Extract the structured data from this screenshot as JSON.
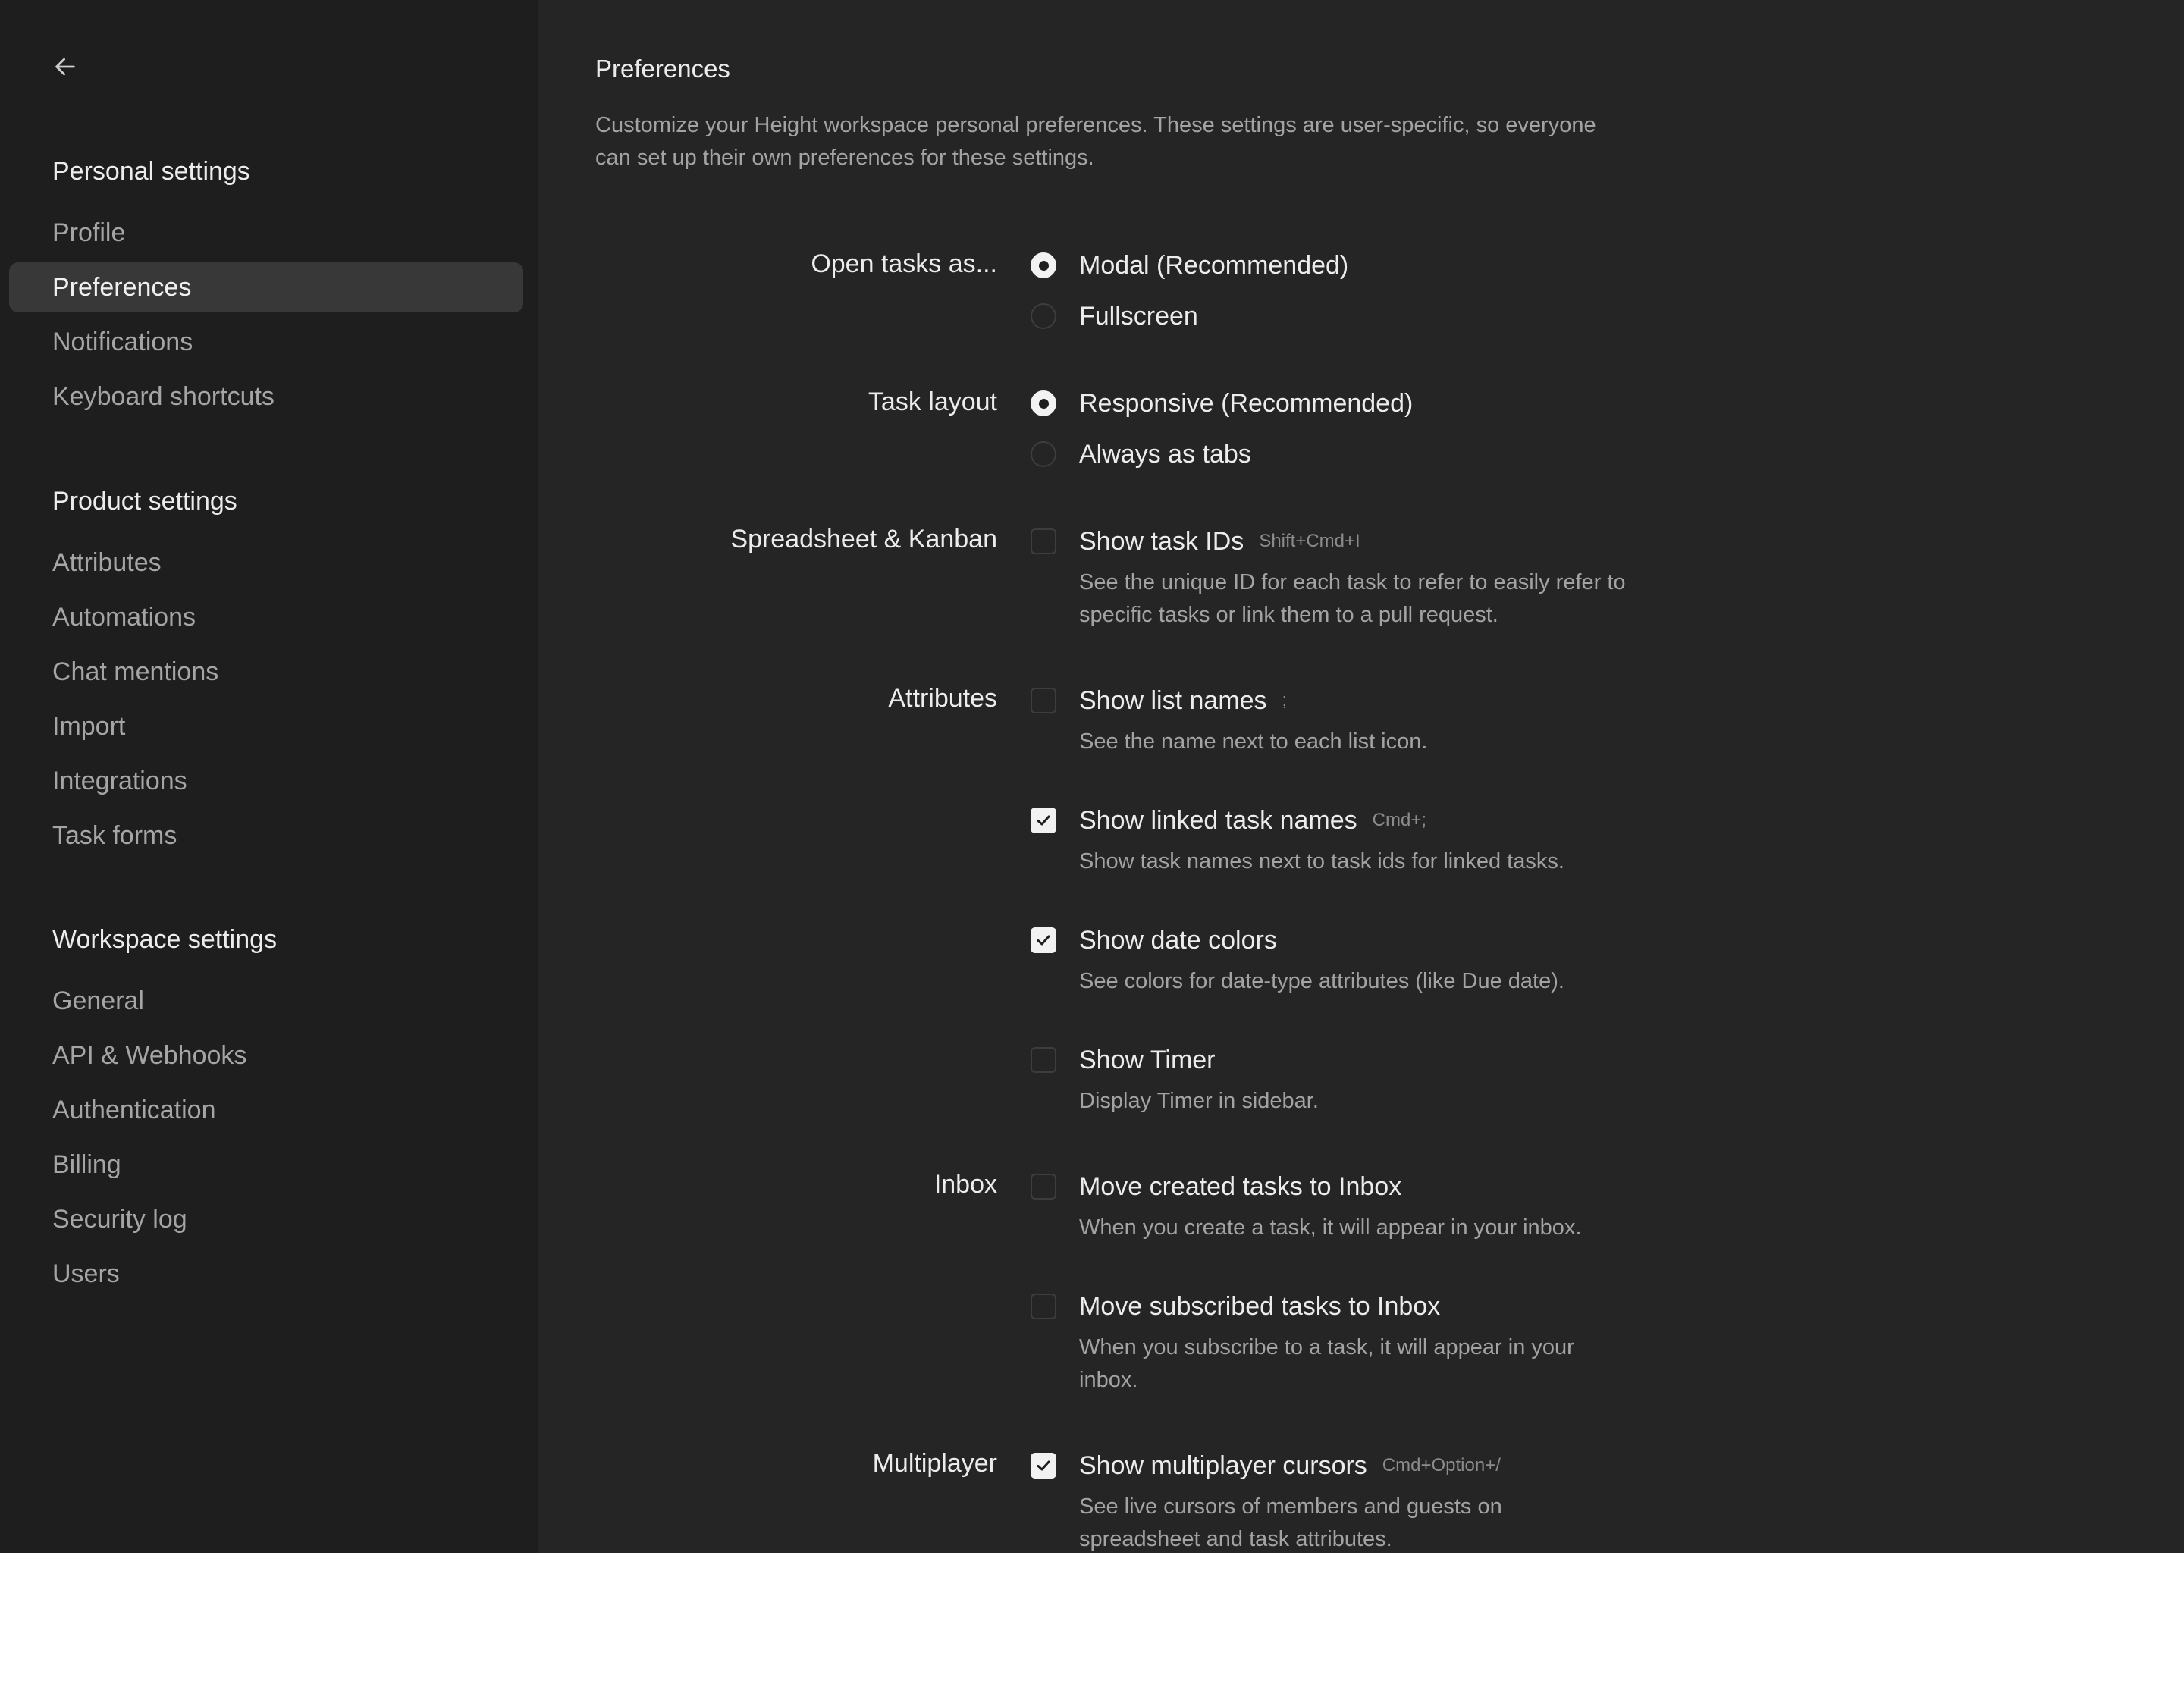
{
  "sidebar": {
    "back_icon": "arrow-left-icon",
    "sections": [
      {
        "heading": "Personal settings",
        "items": [
          {
            "label": "Profile",
            "active": false
          },
          {
            "label": "Preferences",
            "active": true
          },
          {
            "label": "Notifications",
            "active": false
          },
          {
            "label": "Keyboard shortcuts",
            "active": false
          }
        ]
      },
      {
        "heading": "Product settings",
        "items": [
          {
            "label": "Attributes",
            "active": false
          },
          {
            "label": "Automations",
            "active": false
          },
          {
            "label": "Chat mentions",
            "active": false
          },
          {
            "label": "Import",
            "active": false
          },
          {
            "label": "Integrations",
            "active": false
          },
          {
            "label": "Task forms",
            "active": false
          }
        ]
      },
      {
        "heading": "Workspace settings",
        "items": [
          {
            "label": "General",
            "active": false
          },
          {
            "label": "API & Webhooks",
            "active": false
          },
          {
            "label": "Authentication",
            "active": false
          },
          {
            "label": "Billing",
            "active": false
          },
          {
            "label": "Security log",
            "active": false
          },
          {
            "label": "Users",
            "active": false
          }
        ]
      }
    ]
  },
  "main": {
    "title": "Preferences",
    "description": "Customize your Height workspace personal preferences. These settings are user-specific, so everyone can set up their own preferences for these settings.",
    "groups": {
      "open_tasks": {
        "label": "Open tasks as...",
        "options": [
          {
            "label": "Modal (Recommended)",
            "selected": true
          },
          {
            "label": "Fullscreen",
            "selected": false
          }
        ]
      },
      "task_layout": {
        "label": "Task layout",
        "options": [
          {
            "label": "Responsive (Recommended)",
            "selected": true
          },
          {
            "label": "Always as tabs",
            "selected": false
          }
        ]
      },
      "spreadsheet": {
        "label": "Spreadsheet & Kanban",
        "options": [
          {
            "label": "Show task IDs",
            "shortcut": "Shift+Cmd+I",
            "checked": false,
            "description": "See the unique ID for each task to refer to easily refer to specific tasks or link them to a pull request."
          }
        ]
      },
      "attributes": {
        "label": "Attributes",
        "options": [
          {
            "label": "Show list names",
            "shortcut": ";",
            "checked": false,
            "description": "See the name next to each list icon."
          },
          {
            "label": "Show linked task names",
            "shortcut": "Cmd+;",
            "checked": true,
            "description": "Show task names next to task ids for linked tasks."
          },
          {
            "label": "Show date colors",
            "shortcut": "",
            "checked": true,
            "description": "See colors for date-type attributes (like Due date)."
          },
          {
            "label": "Show Timer",
            "shortcut": "",
            "checked": false,
            "description": "Display Timer in sidebar."
          }
        ]
      },
      "inbox": {
        "label": "Inbox",
        "options": [
          {
            "label": "Move created tasks to Inbox",
            "shortcut": "",
            "checked": false,
            "description": "When you create a task, it will appear in your inbox."
          },
          {
            "label": "Move subscribed tasks to Inbox",
            "shortcut": "",
            "checked": false,
            "description": "When you subscribe to a task, it will appear in your inbox."
          }
        ]
      },
      "multiplayer": {
        "label": "Multiplayer",
        "options": [
          {
            "label": "Show multiplayer cursors",
            "shortcut": "Cmd+Option+/",
            "checked": true,
            "description": "See live cursors of members and guests on spreadsheet and task attributes."
          }
        ]
      }
    }
  }
}
